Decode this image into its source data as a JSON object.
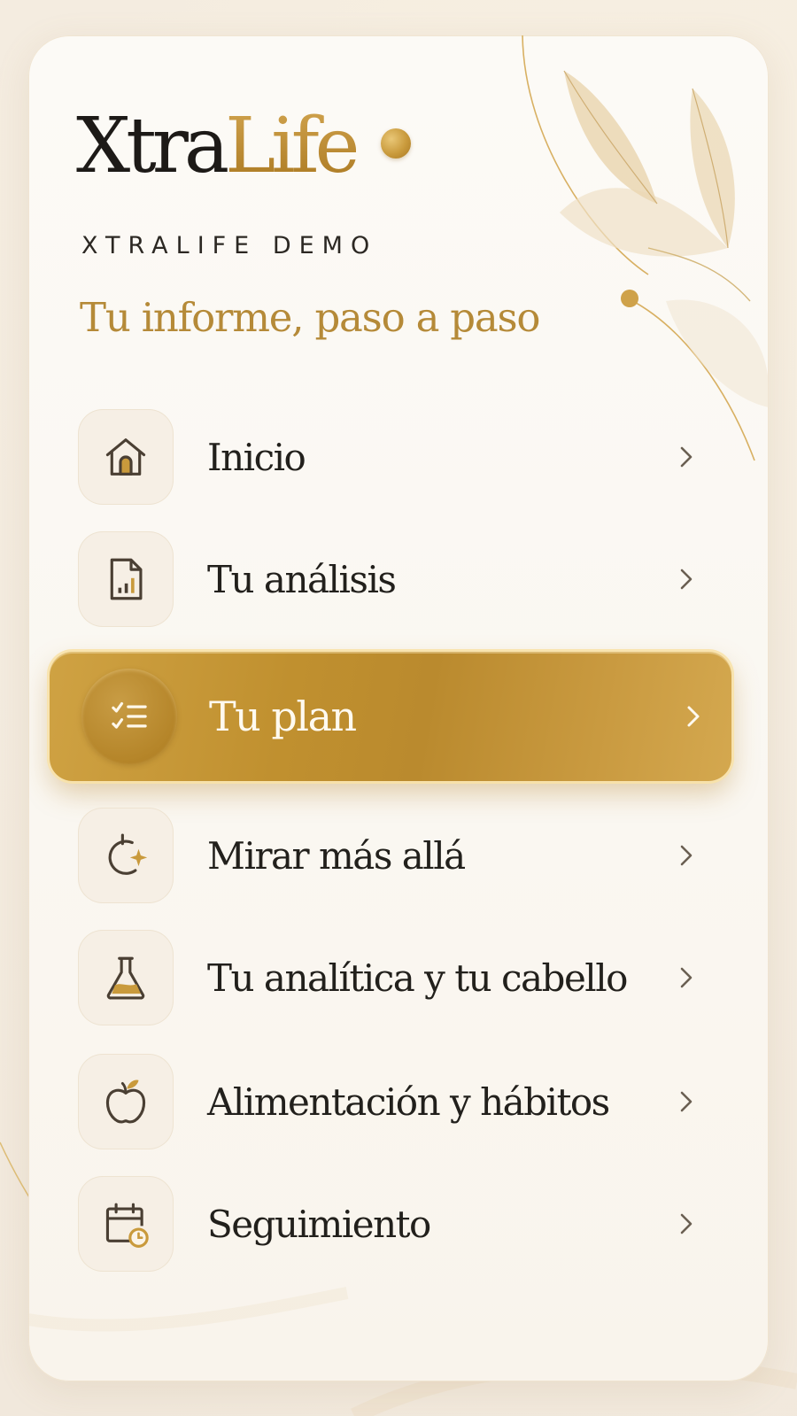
{
  "app": {
    "logo_part1": "Xtra",
    "logo_part2": "Life",
    "subtitle": "XTRALIFE DEMO",
    "tagline": "Tu informe, paso a paso"
  },
  "colors": {
    "accent_gold": "#c0902f",
    "text_dark": "#22201c",
    "tagline_gold": "#b58a38",
    "background": "#f4ece0"
  },
  "menu": {
    "items": [
      {
        "label": "Inicio",
        "icon": "home-icon",
        "active": false
      },
      {
        "label": "Tu análisis",
        "icon": "report-icon",
        "active": false
      },
      {
        "label": "Tu plan",
        "icon": "checklist-icon",
        "active": true
      },
      {
        "label": "Mirar más allá",
        "icon": "refresh-sparkle-icon",
        "active": false
      },
      {
        "label": "Tu analítica y tu cabello",
        "icon": "flask-icon",
        "active": false
      },
      {
        "label": "Alimentación y hábitos",
        "icon": "apple-icon",
        "active": false
      },
      {
        "label": "Seguimiento",
        "icon": "calendar-clock-icon",
        "active": false
      }
    ]
  }
}
